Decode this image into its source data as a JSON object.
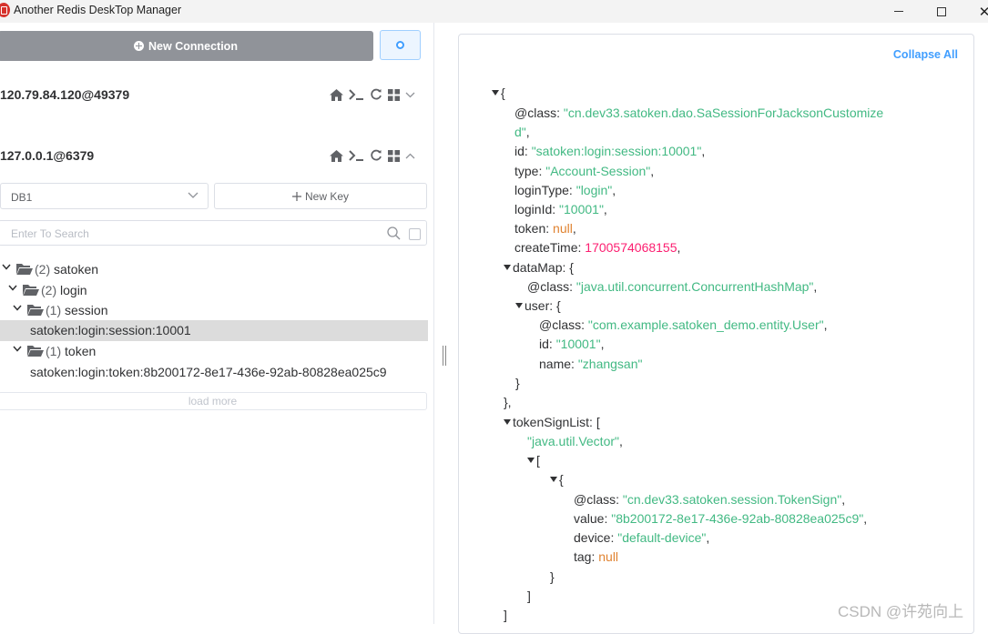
{
  "window": {
    "title": "Another Redis DeskTop Manager",
    "minimize": "minimize",
    "maximize": "maximize",
    "close": "✕"
  },
  "toolbar": {
    "new_connection_label": "New Connection"
  },
  "connections": [
    {
      "name": "120.79.84.120@49379"
    },
    {
      "name": "127.0.0.1@6379"
    }
  ],
  "db_selector": {
    "value": "DB1"
  },
  "new_key_label": "New Key",
  "search": {
    "placeholder": "Enter To Search"
  },
  "tree": {
    "satoken": {
      "count": "(2)",
      "name": "satoken"
    },
    "login": {
      "count": "(2)",
      "name": "login"
    },
    "session": {
      "count": "(1)",
      "name": "session"
    },
    "session_key": "satoken:login:session:10001",
    "token": {
      "count": "(1)",
      "name": "token"
    },
    "token_key": "satoken:login:token:8b200172-8e17-436e-92ab-80828ea025c9"
  },
  "load_more_label": "load more",
  "viewer": {
    "collapse_all_label": "Collapse All",
    "lines": {
      "l1": "{",
      "class_key": "@class:",
      "class_val_a": "\"cn.dev33.satoken.dao.SaSessionForJacksonCustomize",
      "class_val_b": "d\"",
      "comma": ",",
      "id_key": "id:",
      "id_val": "\"satoken:login:session:10001\"",
      "type_key": "type:",
      "type_val": "\"Account-Session\"",
      "logintype_key": "loginType:",
      "logintype_val": "\"login\"",
      "loginid_key": "loginId:",
      "loginid_val": "\"10001\"",
      "token_key": "token:",
      "token_val": "null",
      "ctime_key": "createTime:",
      "ctime_val": "1700574068155",
      "datamap_key": "dataMap: {",
      "dm_class_key": "@class:",
      "dm_class_val": "\"java.util.concurrent.ConcurrentHashMap\"",
      "user_key": "user: {",
      "u_class_key": "@class:",
      "u_class_val": "\"com.example.satoken_demo.entity.User\"",
      "u_id_key": "id:",
      "u_id_val": "\"10001\"",
      "u_name_key": "name:",
      "u_name_val": "\"zhangsan\"",
      "close_brace": "}",
      "close_brace_comma": "},",
      "tsl_key": "tokenSignList: [",
      "tsl_vector": "\"java.util.Vector\"",
      "open_bracket": "[",
      "open_brace": "{",
      "ts_class_key": "@class:",
      "ts_class_val": "\"cn.dev33.satoken.session.TokenSign\"",
      "ts_value_key": "value:",
      "ts_value_val": "\"8b200172-8e17-436e-92ab-80828ea025c9\"",
      "ts_device_key": "device:",
      "ts_device_val": "\"default-device\"",
      "ts_tag_key": "tag:",
      "ts_tag_val": "null",
      "close_bracket": "]"
    }
  },
  "watermark": "CSDN @许苑向上"
}
